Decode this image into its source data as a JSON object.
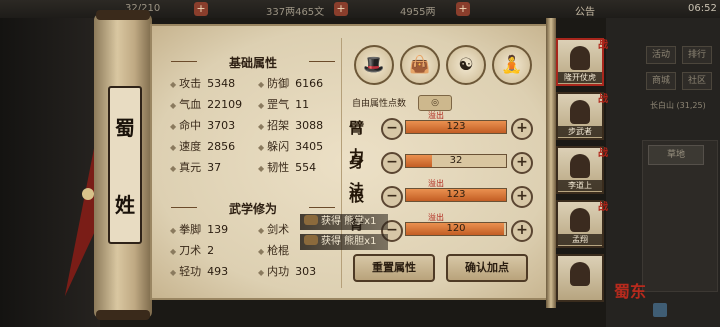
{
  "topbar": {
    "stamina": "32/210",
    "money": "337两465文",
    "gold": "4955两",
    "announce": "公告",
    "time": "06:52"
  },
  "character": {
    "name_chars": [
      "蜀",
      "姓"
    ]
  },
  "basic": {
    "title": "基础属性",
    "stats": [
      {
        "label": "攻击",
        "value": "5348"
      },
      {
        "label": "防御",
        "value": "6166"
      },
      {
        "label": "气血",
        "value": "22109"
      },
      {
        "label": "罡气",
        "value": "11"
      },
      {
        "label": "命中",
        "value": "3703"
      },
      {
        "label": "招架",
        "value": "3088"
      },
      {
        "label": "速度",
        "value": "2856"
      },
      {
        "label": "躲闪",
        "value": "3405"
      },
      {
        "label": "真元",
        "value": "37"
      },
      {
        "label": "韧性",
        "value": "554"
      }
    ]
  },
  "martial": {
    "title": "武学修为",
    "stats": [
      {
        "label": "拳脚",
        "value": "139"
      },
      {
        "label": "剑术",
        "value": ""
      },
      {
        "label": "刀术",
        "value": "2"
      },
      {
        "label": "枪棍",
        "value": ""
      },
      {
        "label": "轻功",
        "value": "493"
      },
      {
        "label": "内功",
        "value": "303"
      }
    ]
  },
  "attr_icons": [
    "hat-icon",
    "bag-icon",
    "yinyang-icon",
    "body-icon"
  ],
  "free_points": {
    "label": "自由属性点数",
    "value": "◎"
  },
  "attributes": [
    {
      "name": "臂力",
      "value": "123",
      "overflow": "溢出",
      "fill": 1.0
    },
    {
      "name": "身法",
      "value": "32",
      "overflow": "",
      "fill": 0.26
    },
    {
      "name": "根骨",
      "value": "123",
      "overflow": "溢出",
      "fill": 1.0
    },
    {
      "name": "",
      "value": "120",
      "overflow": "溢出",
      "fill": 0.98
    }
  ],
  "buttons": {
    "reset": "重置属性",
    "confirm": "确认加点"
  },
  "toasts": [
    "获得 熊掌x1",
    "获得 熊胆x1"
  ],
  "team": [
    {
      "name": "隆开仗虎",
      "badge": "战"
    },
    {
      "name": "步武者",
      "badge": "战"
    },
    {
      "name": "李道上",
      "badge": "战"
    },
    {
      "name": "孟翔",
      "badge": "战"
    },
    {
      "name": "",
      "badge": ""
    }
  ],
  "menu": [
    "活动",
    "排行",
    "商城",
    "社区"
  ],
  "location": "长白山 (31,25)",
  "map_tab": "草地",
  "bottom_glyph": "蜀东"
}
